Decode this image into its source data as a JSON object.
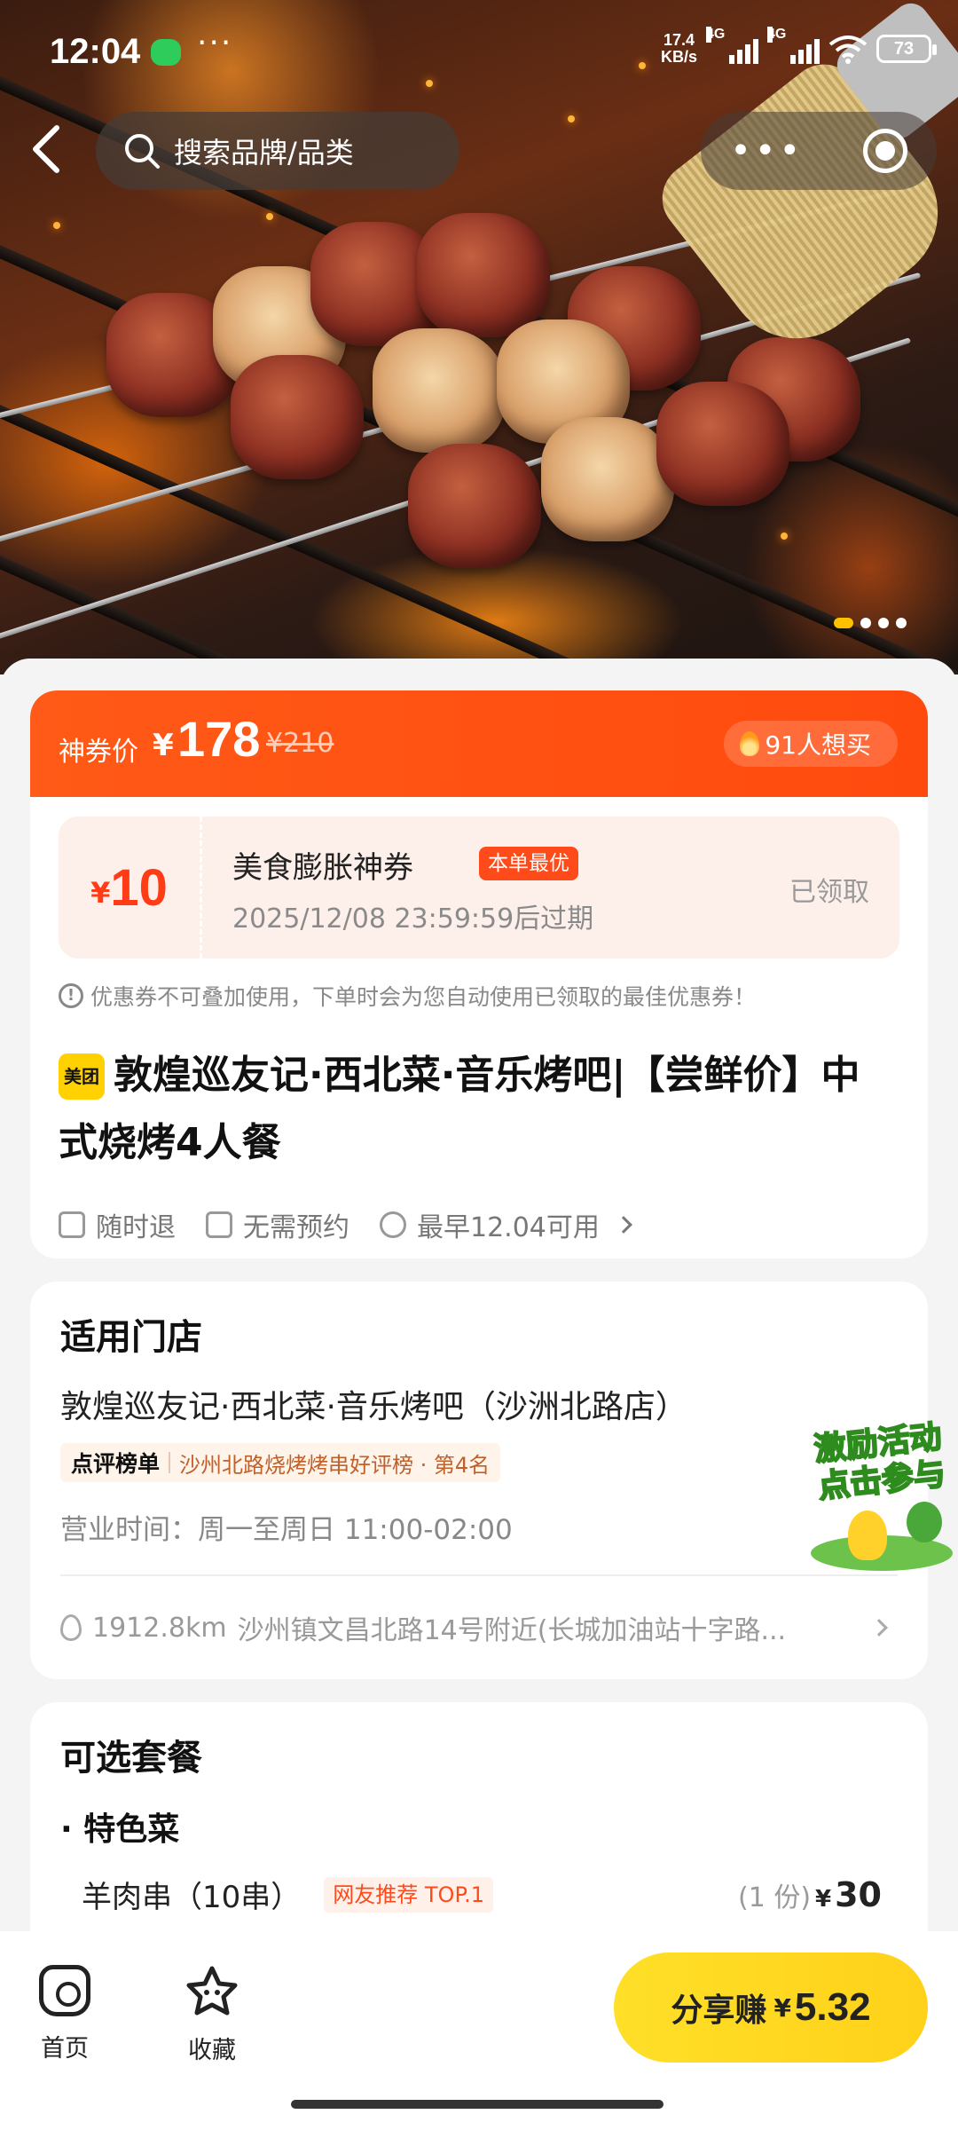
{
  "status_bar": {
    "time": "12:04",
    "more": "···",
    "net_speed_value": "17.4",
    "net_speed_unit": "KB/s",
    "signal1_label": "4G",
    "signal2_label": "4G",
    "battery": "73"
  },
  "nav": {
    "search_placeholder": "搜索品牌/品类",
    "capsule_more": "•••"
  },
  "hero": {
    "image_count": 4,
    "active_index": 0
  },
  "price": {
    "label": "神券价",
    "currency": "¥",
    "current": "178",
    "original": "¥210",
    "want_count": "91人想买"
  },
  "coupon": {
    "currency": "¥",
    "amount": "10",
    "title": "美食膨胀神券",
    "tag": "本单最优",
    "expire": "2025/12/08 23:59:59后过期",
    "status": "已领取"
  },
  "notice": "优惠券不可叠加使用，下单时会为您自动使用已领取的最佳优惠券！",
  "deal": {
    "brand_badge": "美团",
    "title": "敦煌巡友记·西北菜·音乐烤吧|【尝鲜价】中式烧烤4人餐",
    "features": [
      "随时退",
      "无需预约",
      "最早12.04可用"
    ]
  },
  "stores": {
    "section_title": "适用门店",
    "name": "敦煌巡友记·西北菜·音乐烤吧（沙洲北路店）",
    "rank_brand": "点评榜单",
    "rank_text": "沙州北路烧烤烤串好评榜 · 第4名",
    "hours": "营业时间：周一至周日 11:00-02:00",
    "distance": "1912.8km",
    "address": "沙州镇文昌北路14号附近(长城加油站十字路..."
  },
  "packages": {
    "section_title": "可选套餐",
    "category": "· 特色菜",
    "items": [
      {
        "name": "羊肉串（10串）",
        "tag": "网友推荐 TOP.1",
        "qty": "(1 份)",
        "currency": "¥",
        "price": "30"
      }
    ]
  },
  "promo": {
    "line1": "激励活动",
    "line2": "点击参与"
  },
  "bottom_bar": {
    "home_label": "首页",
    "favorite_label": "收藏",
    "share_label": "分享赚",
    "share_currency": "¥",
    "share_amount": "5.32"
  }
}
